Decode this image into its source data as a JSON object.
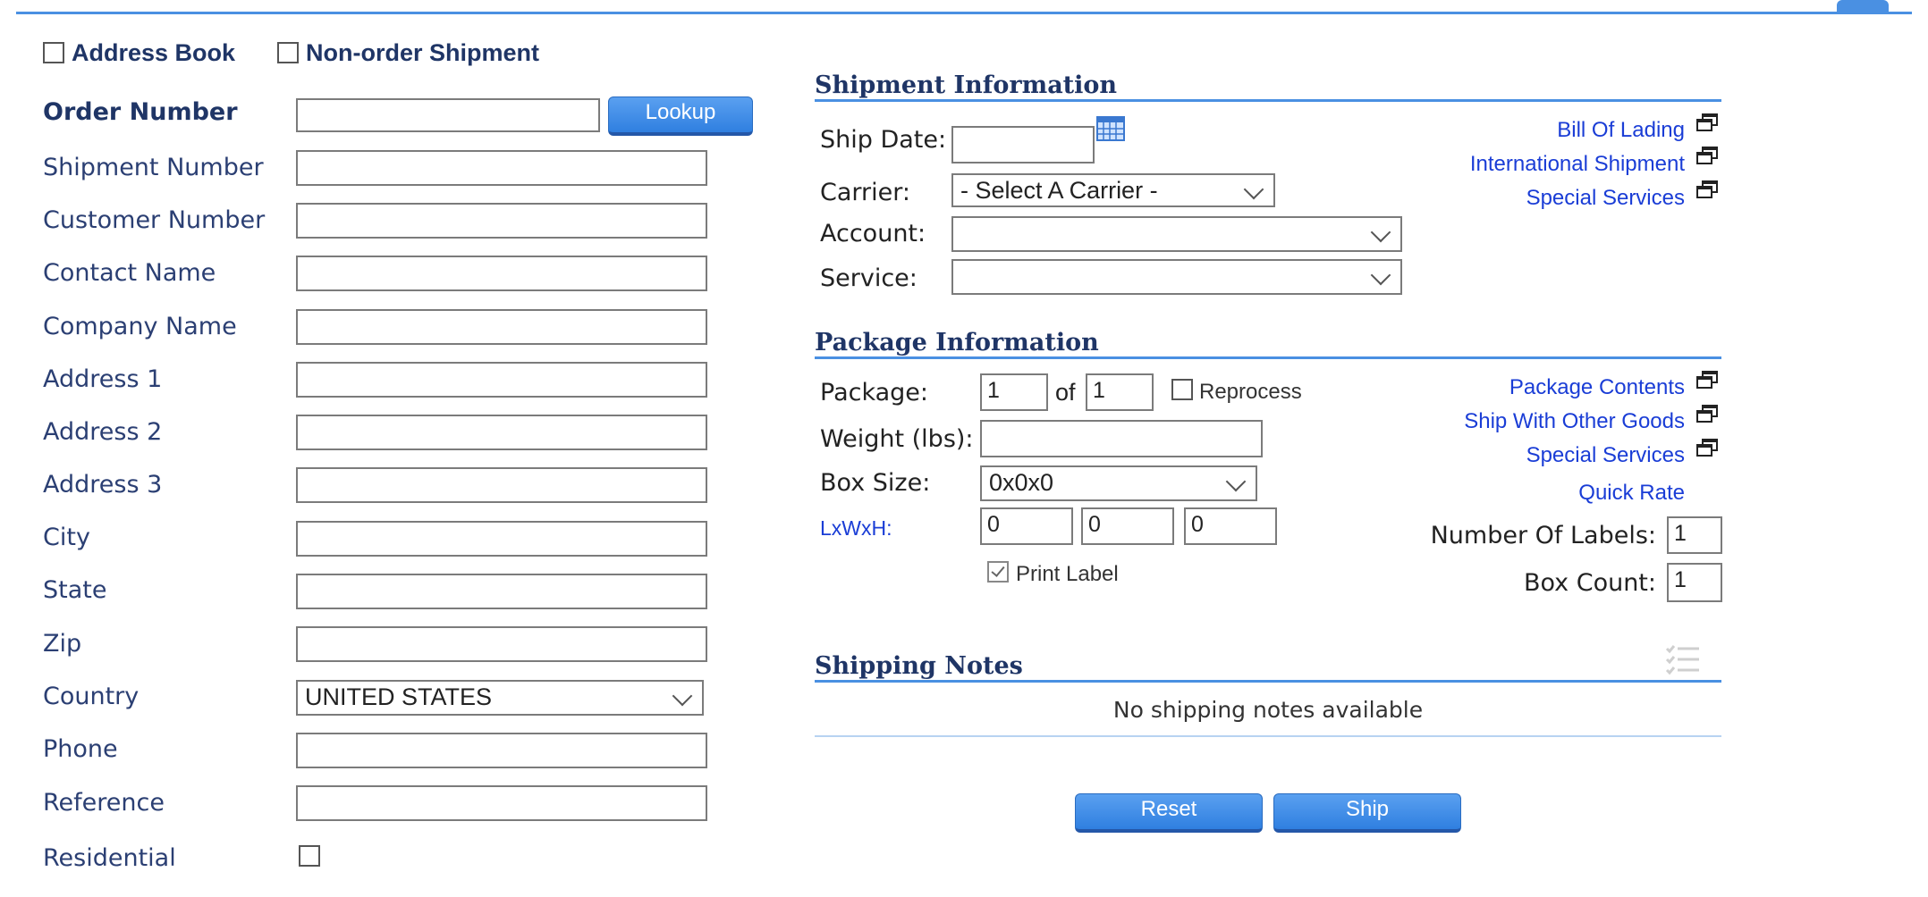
{
  "colors": {
    "accent": "#4a90e2",
    "button": "#2f7fe0",
    "link": "#1a3dd6",
    "label": "#2b3f73"
  },
  "top_checkboxes": {
    "address_book": "Address Book",
    "non_order_shipment": "Non-order Shipment"
  },
  "lookup_button": "Lookup",
  "address_form": {
    "order_number": "Order Number",
    "shipment_number": "Shipment Number",
    "customer_number": "Customer Number",
    "contact_name": "Contact Name",
    "company_name": "Company Name",
    "address1": "Address 1",
    "address2": "Address 2",
    "address3": "Address 3",
    "city": "City",
    "state": "State",
    "zip": "Zip",
    "country": "Country",
    "country_value": "UNITED STATES",
    "phone": "Phone",
    "reference": "Reference",
    "residential": "Residential"
  },
  "shipment": {
    "title": "Shipment Information",
    "ship_date": "Ship Date:",
    "carrier": "Carrier:",
    "carrier_value": "- Select A Carrier -",
    "account": "Account:",
    "service": "Service:",
    "links": {
      "bill_of_lading": "Bill Of Lading",
      "international": "International Shipment",
      "special_services": "Special Services"
    }
  },
  "package": {
    "title": "Package Information",
    "package": "Package:",
    "package_value": "1",
    "of": "of",
    "of_value": "1",
    "reprocess": "Reprocess",
    "weight": "Weight (lbs):",
    "box_size": "Box Size:",
    "box_size_value": "0x0x0",
    "lxwxh": "LxWxH:",
    "l": "0",
    "w": "0",
    "h": "0",
    "print_label": "Print Label",
    "links": {
      "package_contents": "Package Contents",
      "ship_with_other": "Ship With Other Goods",
      "special_services": "Special Services",
      "quick_rate": "Quick Rate"
    },
    "number_of_labels": "Number Of Labels:",
    "number_of_labels_value": "1",
    "box_count": "Box Count:",
    "box_count_value": "1"
  },
  "notes": {
    "title": "Shipping Notes",
    "empty": "No shipping notes available"
  },
  "buttons": {
    "reset": "Reset",
    "ship": "Ship"
  }
}
